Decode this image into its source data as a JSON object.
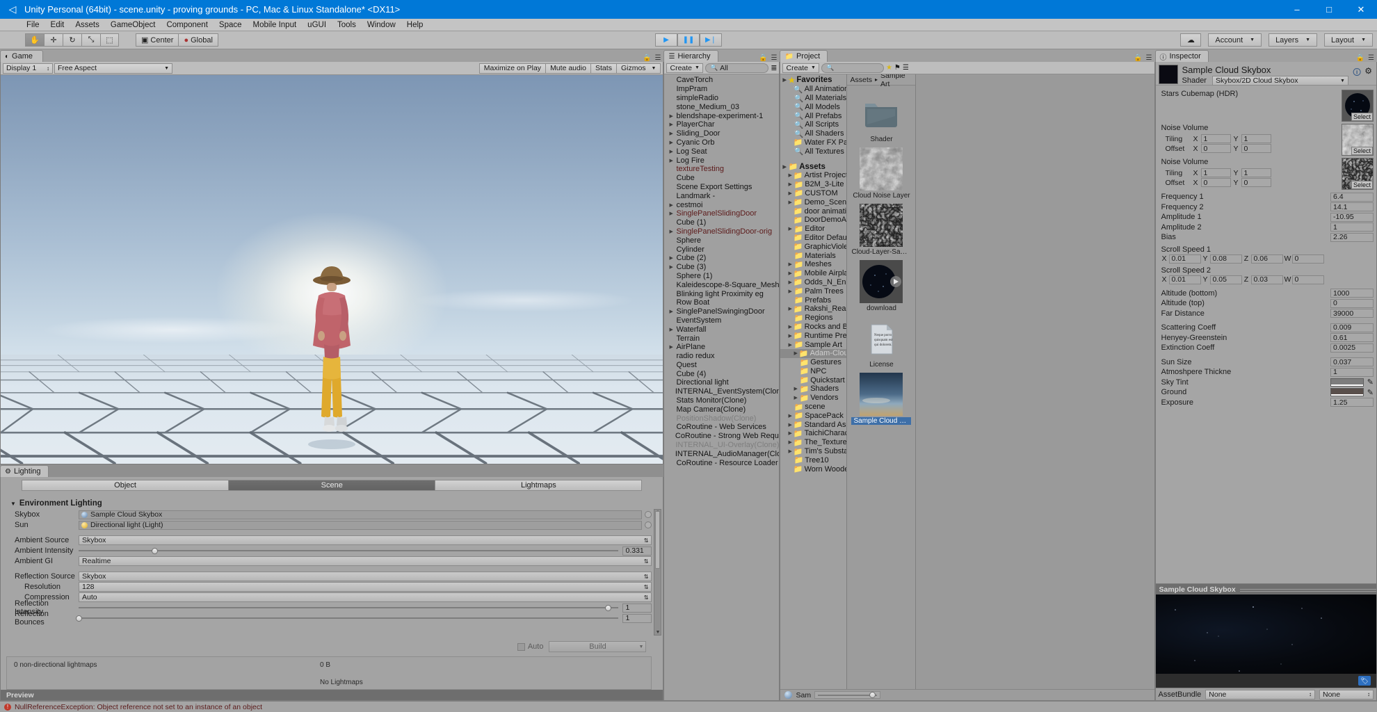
{
  "window": {
    "title": "Unity Personal (64bit) - scene.unity - proving grounds - PC, Mac & Linux Standalone* <DX11>",
    "minimize": "–",
    "maximize": "□",
    "close": "✕"
  },
  "menu": [
    "File",
    "Edit",
    "Assets",
    "GameObject",
    "Component",
    "Space",
    "Mobile Input",
    "uGUI",
    "Tools",
    "Window",
    "Help"
  ],
  "toolbar": {
    "tools": [
      "✋",
      "✛",
      "↻",
      "⤡",
      "⬚"
    ],
    "pivot": "Center",
    "handle": "Global",
    "play": "▶",
    "pause": "❚❚",
    "step": "▶❘",
    "cloud": "☁",
    "account": "Account",
    "layers": "Layers",
    "layout": "Layout"
  },
  "game": {
    "tab": "Game",
    "tab_icon": "game-icon",
    "display": "Display 1",
    "aspect": "Free Aspect",
    "right_buttons": [
      "Maximize on Play",
      "Mute audio",
      "Stats",
      "Gizmos"
    ]
  },
  "lighting": {
    "tab": "Lighting",
    "modes": [
      "Object",
      "Scene",
      "Lightmaps"
    ],
    "active_mode": "Scene",
    "section_title": "Environment Lighting",
    "rows": [
      {
        "label": "Skybox",
        "type": "object",
        "value": "Sample Cloud Skybox",
        "icon": "material-sphere-icon"
      },
      {
        "label": "Sun",
        "type": "object",
        "value": "Directional light (Light)",
        "icon": "light-icon"
      },
      {
        "label": "Ambient Source",
        "type": "popup",
        "value": "Skybox"
      },
      {
        "label": "Ambient Intensity",
        "type": "slider",
        "value": "0.331",
        "pct": 14
      },
      {
        "label": "Ambient GI",
        "type": "popup",
        "value": "Realtime"
      },
      {
        "label": "Reflection Source",
        "type": "popup",
        "value": "Skybox"
      },
      {
        "label": "Resolution",
        "type": "popup",
        "value": "128",
        "indent": true
      },
      {
        "label": "Compression",
        "type": "popup",
        "value": "Auto",
        "indent": true
      },
      {
        "label": "Reflection Intensity",
        "type": "slider",
        "value": "1",
        "pct": 98
      },
      {
        "label": "Reflection Bounces",
        "type": "slider",
        "value": "1",
        "pct": 0
      }
    ],
    "auto_label": "Auto",
    "build_label": "Build",
    "lightmaps_count": "0 non-directional lightmaps",
    "lightmaps_size": "0 B",
    "lightmaps_status": "No Lightmaps",
    "preview_label": "Preview"
  },
  "hierarchy": {
    "tab": "Hierarchy",
    "create_label": "Create",
    "search_placeholder": "All",
    "items": [
      {
        "label": "CaveTorch",
        "expand": false,
        "style": "normal"
      },
      {
        "label": "ImpPram",
        "expand": false,
        "style": "normal"
      },
      {
        "label": "simpleRadio",
        "expand": false,
        "style": "normal"
      },
      {
        "label": "stone_Medium_03",
        "expand": false,
        "style": "normal"
      },
      {
        "label": "blendshape-experiment-1",
        "expand": true,
        "style": "normal"
      },
      {
        "label": "PlayerChar",
        "expand": true,
        "style": "normal"
      },
      {
        "label": "Sliding_Door",
        "expand": true,
        "style": "normal"
      },
      {
        "label": "Cyanic Orb",
        "expand": true,
        "style": "normal"
      },
      {
        "label": "Log Seat",
        "expand": true,
        "style": "normal"
      },
      {
        "label": "Log Fire",
        "expand": true,
        "style": "normal"
      },
      {
        "label": "textureTesting",
        "expand": false,
        "style": "prefab"
      },
      {
        "label": "Cube",
        "expand": false,
        "style": "normal"
      },
      {
        "label": "Scene Export Settings",
        "expand": false,
        "style": "normal"
      },
      {
        "label": "Landmark -",
        "expand": false,
        "style": "normal"
      },
      {
        "label": "cestmoi",
        "expand": true,
        "style": "normal"
      },
      {
        "label": "SinglePanelSlidingDoor",
        "expand": true,
        "style": "prefab"
      },
      {
        "label": "Cube (1)",
        "expand": false,
        "style": "normal"
      },
      {
        "label": "SinglePanelSlidingDoor-orig",
        "expand": true,
        "style": "prefab"
      },
      {
        "label": "Sphere",
        "expand": false,
        "style": "normal"
      },
      {
        "label": "Cylinder",
        "expand": false,
        "style": "normal"
      },
      {
        "label": "Cube (2)",
        "expand": true,
        "style": "normal"
      },
      {
        "label": "Cube (3)",
        "expand": true,
        "style": "normal"
      },
      {
        "label": "Sphere (1)",
        "expand": false,
        "style": "normal"
      },
      {
        "label": "Kaleidescope-8-Square_Mesh",
        "expand": false,
        "style": "normal"
      },
      {
        "label": "Blinking light Proximity eg",
        "expand": false,
        "style": "normal"
      },
      {
        "label": "Row Boat",
        "expand": false,
        "style": "normal"
      },
      {
        "label": "SinglePanelSwingingDoor",
        "expand": true,
        "style": "normal"
      },
      {
        "label": "EventSystem",
        "expand": false,
        "style": "normal"
      },
      {
        "label": "Waterfall",
        "expand": true,
        "style": "normal"
      },
      {
        "label": "Terrain",
        "expand": false,
        "style": "normal"
      },
      {
        "label": "AirPlane",
        "expand": true,
        "style": "normal"
      },
      {
        "label": "radio redux",
        "expand": false,
        "style": "normal"
      },
      {
        "label": "Quest",
        "expand": false,
        "style": "normal"
      },
      {
        "label": "Cube (4)",
        "expand": false,
        "style": "normal"
      },
      {
        "label": "Directional light",
        "expand": false,
        "style": "normal"
      },
      {
        "label": "INTERNAL_EventSystem(Clone)",
        "expand": false,
        "style": "normal"
      },
      {
        "label": "Stats Monitor(Clone)",
        "expand": false,
        "style": "normal"
      },
      {
        "label": "Map Camera(Clone)",
        "expand": false,
        "style": "normal"
      },
      {
        "label": "PositionShadow(Clone)",
        "expand": false,
        "style": "dim"
      },
      {
        "label": "CoRoutine - Web Services",
        "expand": false,
        "style": "normal"
      },
      {
        "label": "CoRoutine - Strong Web Request",
        "expand": false,
        "style": "normal"
      },
      {
        "label": "INTERNAL_UI-Overlay(Clone)",
        "expand": false,
        "style": "dim"
      },
      {
        "label": "INTERNAL_AudioManager(Clone)",
        "expand": false,
        "style": "normal"
      },
      {
        "label": "CoRoutine - Resource Loader",
        "expand": false,
        "style": "normal"
      }
    ]
  },
  "project": {
    "tab": "Project",
    "create_label": "Create",
    "search_placeholder": "",
    "breadcrumb": [
      "Assets",
      "Sample Art"
    ],
    "favorites_label": "Favorites",
    "favorites": [
      {
        "label": "All Animations",
        "icon": "search-icon"
      },
      {
        "label": "All Materials",
        "icon": "search-icon"
      },
      {
        "label": "All Models",
        "icon": "search-icon"
      },
      {
        "label": "All Prefabs",
        "icon": "search-icon"
      },
      {
        "label": "All Scripts",
        "icon": "search-icon"
      },
      {
        "label": "All Shaders",
        "icon": "search-icon"
      },
      {
        "label": "Water FX Pack",
        "icon": "folder-star-icon"
      },
      {
        "label": "All Textures",
        "icon": "search-icon"
      }
    ],
    "assets_label": "Assets",
    "tree": [
      {
        "label": "Artist Projects",
        "depth": 1,
        "expand": true,
        "sel": false
      },
      {
        "label": "B2M_3-Lite",
        "depth": 1,
        "expand": true,
        "sel": false
      },
      {
        "label": "CUSTOM",
        "depth": 1,
        "expand": true,
        "sel": false
      },
      {
        "label": "Demo_Scene",
        "depth": 1,
        "expand": true,
        "sel": false
      },
      {
        "label": "door animation",
        "depth": 1,
        "expand": false,
        "sel": false
      },
      {
        "label": "DoorDemoAssets",
        "depth": 1,
        "expand": false,
        "sel": false
      },
      {
        "label": "Editor",
        "depth": 1,
        "expand": true,
        "sel": false
      },
      {
        "label": "Editor Default",
        "depth": 1,
        "expand": false,
        "sel": false
      },
      {
        "label": "GraphicViolence",
        "depth": 1,
        "expand": false,
        "sel": false
      },
      {
        "label": "Materials",
        "depth": 1,
        "expand": false,
        "sel": false
      },
      {
        "label": "Meshes",
        "depth": 1,
        "expand": true,
        "sel": false
      },
      {
        "label": "Mobile Airplane",
        "depth": 1,
        "expand": true,
        "sel": false
      },
      {
        "label": "Odds_N_Ends",
        "depth": 1,
        "expand": true,
        "sel": false
      },
      {
        "label": "Palm Trees",
        "depth": 1,
        "expand": true,
        "sel": false
      },
      {
        "label": "Prefabs",
        "depth": 1,
        "expand": false,
        "sel": false
      },
      {
        "label": "Rakshi_Realm",
        "depth": 1,
        "expand": true,
        "sel": false
      },
      {
        "label": "Regions",
        "depth": 1,
        "expand": false,
        "sel": false
      },
      {
        "label": "Rocks and Boulders",
        "depth": 1,
        "expand": true,
        "sel": false
      },
      {
        "label": "Runtime Preview",
        "depth": 1,
        "expand": true,
        "sel": false
      },
      {
        "label": "Sample Art",
        "depth": 1,
        "expand": true,
        "sel": false
      },
      {
        "label": "Adam-Cloud",
        "depth": 2,
        "expand": true,
        "sel": true
      },
      {
        "label": "Gestures",
        "depth": 2,
        "expand": false,
        "sel": false
      },
      {
        "label": "NPC",
        "depth": 2,
        "expand": false,
        "sel": false
      },
      {
        "label": "Quickstart",
        "depth": 2,
        "expand": false,
        "sel": false
      },
      {
        "label": "Shaders",
        "depth": 2,
        "expand": true,
        "sel": false
      },
      {
        "label": "Vendors",
        "depth": 2,
        "expand": true,
        "sel": false
      },
      {
        "label": "scene",
        "depth": 1,
        "expand": false,
        "sel": false
      },
      {
        "label": "SpacePack",
        "depth": 1,
        "expand": true,
        "sel": false
      },
      {
        "label": "Standard Assets",
        "depth": 1,
        "expand": true,
        "sel": false
      },
      {
        "label": "TaichiCharacter",
        "depth": 1,
        "expand": true,
        "sel": false
      },
      {
        "label": "The_Textures",
        "depth": 1,
        "expand": true,
        "sel": false
      },
      {
        "label": "Tim's Substance",
        "depth": 1,
        "expand": true,
        "sel": false
      },
      {
        "label": "Tree10",
        "depth": 1,
        "expand": false,
        "sel": false
      },
      {
        "label": "Worn Wooden",
        "depth": 1,
        "expand": false,
        "sel": false
      }
    ],
    "assets": [
      {
        "label": "Shader",
        "kind": "folder",
        "selected": false
      },
      {
        "label": "Cloud Noise Layer",
        "kind": "noise-texture",
        "selected": false
      },
      {
        "label": "Cloud-Layer-Sam...",
        "kind": "dark-noise-texture",
        "selected": false
      },
      {
        "label": "download",
        "kind": "cubemap",
        "selected": false
      },
      {
        "label": "License",
        "kind": "text-doc",
        "selected": false,
        "doc_text": "Neque porro quisquam est qui dolorem."
      },
      {
        "label": "Sample Cloud Sk...",
        "kind": "material",
        "selected": true
      }
    ],
    "footer_label": "Sam"
  },
  "inspector": {
    "tab": "Inspector",
    "material_name": "Sample Cloud Skybox",
    "shader_label": "Shader",
    "shader_value": "Skybox/2D Cloud Skybox",
    "help_icon": "help-icon",
    "gear_icon": "gear-icon",
    "select_label": "Select",
    "textures": [
      {
        "name": "Stars Cubemap (HDR)",
        "kind": "cubemap",
        "tiling": null,
        "offset": null
      },
      {
        "name": "Noise Volume",
        "kind": "noise",
        "tiling": {
          "x": "1",
          "y": "1"
        },
        "offset": {
          "x": "0",
          "y": "0"
        }
      },
      {
        "name": "Noise Volume",
        "kind": "darknoise",
        "tiling": {
          "x": "1",
          "y": "1"
        },
        "offset": {
          "x": "0",
          "y": "0"
        }
      }
    ],
    "tiling_label": "Tiling",
    "offset_label": "Offset",
    "properties": [
      {
        "label": "Frequency 1",
        "value": "6.4",
        "type": "num"
      },
      {
        "label": "Frequency 2",
        "value": "14.1",
        "type": "num"
      },
      {
        "label": "Amplitude 1",
        "value": "-10.95",
        "type": "num"
      },
      {
        "label": "Amplitude 2",
        "value": "1",
        "type": "num"
      },
      {
        "label": "Bias",
        "value": "2.26",
        "type": "num"
      }
    ],
    "vectors": [
      {
        "label": "Scroll Speed 1",
        "x": "0.01",
        "y": "0.08",
        "z": "0.06",
        "w": "0"
      },
      {
        "label": "Scroll Speed 2",
        "x": "0.01",
        "y": "0.05",
        "z": "0.03",
        "w": "0"
      }
    ],
    "properties2": [
      {
        "label": "Altitude (bottom)",
        "value": "1000",
        "type": "num"
      },
      {
        "label": "Altitude (top)",
        "value": "0",
        "type": "num"
      },
      {
        "label": "Far Distance",
        "value": "39000",
        "type": "num"
      }
    ],
    "sliders1": [
      {
        "label": "Scattering Coeff",
        "value": "0.009",
        "pct": 4
      },
      {
        "label": "Henyey-Greenstein",
        "value": "0.61",
        "pct": 57
      }
    ],
    "properties3": [
      {
        "label": "Extinction Coeff",
        "value": "0.0025",
        "type": "num"
      }
    ],
    "sliders2": [
      {
        "label": "Sun Size",
        "value": "0.037",
        "pct": 2
      },
      {
        "label": "Atmoshpere Thickne",
        "value": "1",
        "pct": 12
      }
    ],
    "colors": [
      {
        "label": "Sky Tint",
        "hex": "#7d7d7d"
      },
      {
        "label": "Ground",
        "hex": "#594f4b"
      }
    ],
    "sliders3": [
      {
        "label": "Exposure",
        "value": "1.25",
        "pct": 16
      }
    ],
    "preview_title": "Sample Cloud Skybox",
    "assetbundle_label": "AssetBundle",
    "assetbundle_value": "None",
    "assetbundle_variant": "None",
    "tag_icon": "tag-icon"
  },
  "status": {
    "icon": "error-icon",
    "message": "NullReferenceException: Object reference not set to an instance of an object"
  }
}
